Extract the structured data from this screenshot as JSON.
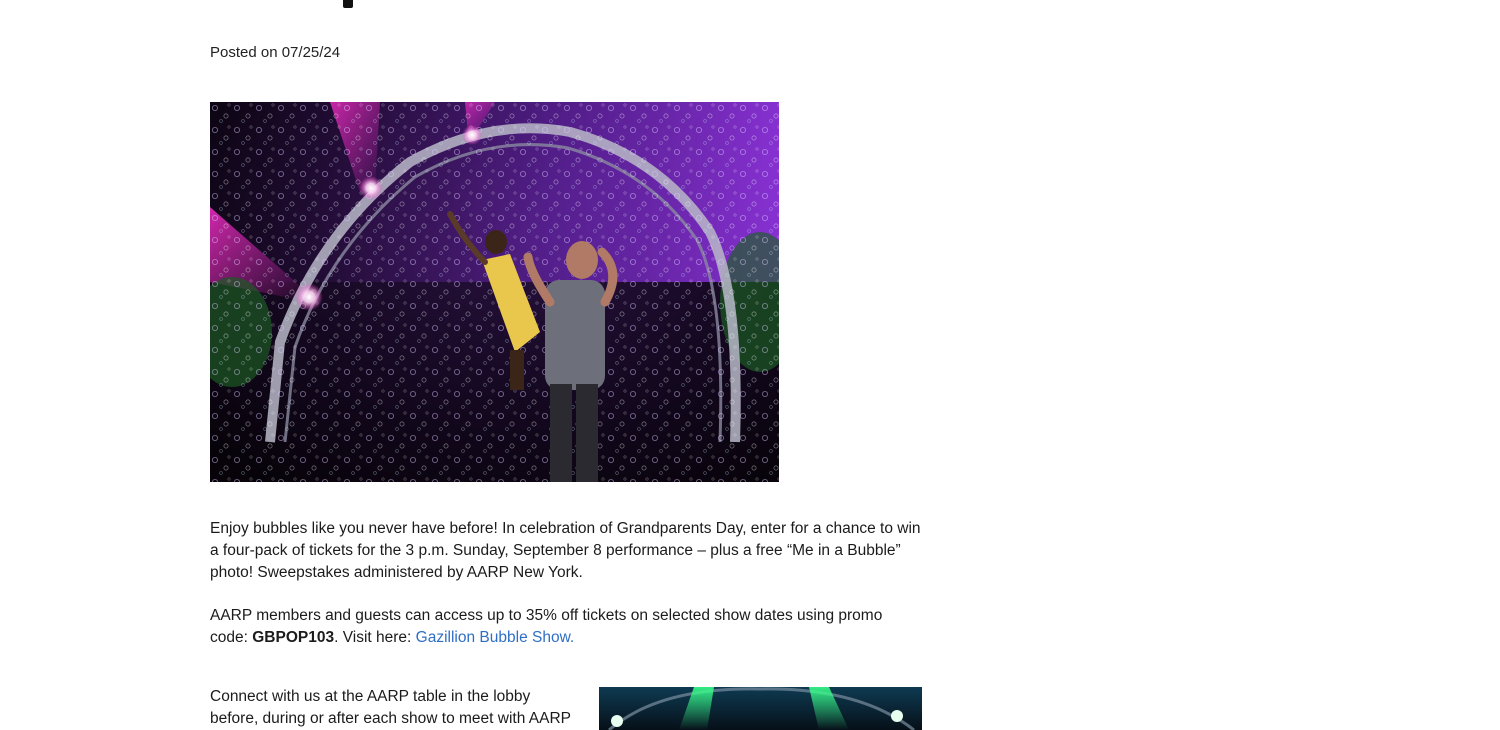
{
  "article": {
    "posted": "Posted on 07/25/24",
    "hero_image_alt": "Performer lifting a child under a bubble-filled lighted arch",
    "paragraph1": "Enjoy bubbles like you never have before! In celebration of Grandparents Day, enter for a chance to win a four-pack of tickets for the 3 p.m. Sunday, September 8 performance – plus a free “Me in a Bubble” photo! Sweepstakes administered by AARP New York.",
    "paragraph2_prefix": "AARP members and guests can access up to 35% off tickets on selected show dates using promo code:",
    "promo_code": "GBPOP103",
    "paragraph2_middle": ". Visit here:",
    "link_text": "Gazillion Bubble Show.",
    "paragraph3": "Connect with us at the AARP table in the lobby before, during or after each show to meet with AARP",
    "second_image_alt": "Stage with green spotlights"
  },
  "colors": {
    "link": "#2f6fc4",
    "text": "#1b1b1b",
    "background": "#ffffff"
  }
}
